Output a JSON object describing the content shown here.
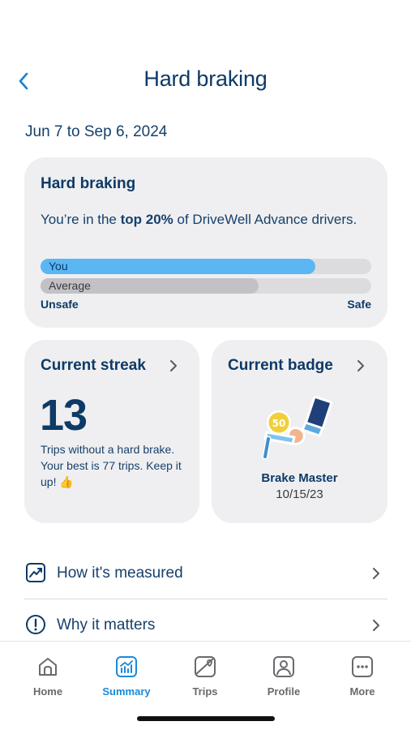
{
  "header": {
    "title": "Hard braking"
  },
  "date_range": "Jun 7 to Sep 6, 2024",
  "summary_card": {
    "title": "Hard braking",
    "text_before": "You’re in the ",
    "text_bold": "top 20%",
    "text_after": " of DriveWell Advance drivers.",
    "you_label": "You",
    "you_fraction": 0.83,
    "average_label": "Average",
    "average_fraction": 0.66,
    "scale_left": "Unsafe",
    "scale_right": "Safe",
    "colors": {
      "you": "#5bb6f4",
      "average": "#c2c2c6"
    }
  },
  "streak_card": {
    "title": "Current streak",
    "value": "13",
    "text": "Trips without a hard brake. Your best is 77 trips. Keep it up! 👍"
  },
  "badge_card": {
    "title": "Current badge",
    "badge_number": "50",
    "badge_name": "Brake Master",
    "badge_date": "10/15/23"
  },
  "links": [
    {
      "label": "How it's measured",
      "icon": "trend-chart-icon"
    },
    {
      "label": "Why it matters",
      "icon": "exclamation-circle-icon"
    }
  ],
  "tabbar": {
    "items": [
      {
        "label": "Home",
        "icon": "home-icon"
      },
      {
        "label": "Summary",
        "icon": "summary-chart-icon",
        "active": true
      },
      {
        "label": "Trips",
        "icon": "map-icon"
      },
      {
        "label": "Profile",
        "icon": "profile-icon"
      },
      {
        "label": "More",
        "icon": "more-icon"
      }
    ],
    "active_color": "#1a8ad6"
  }
}
